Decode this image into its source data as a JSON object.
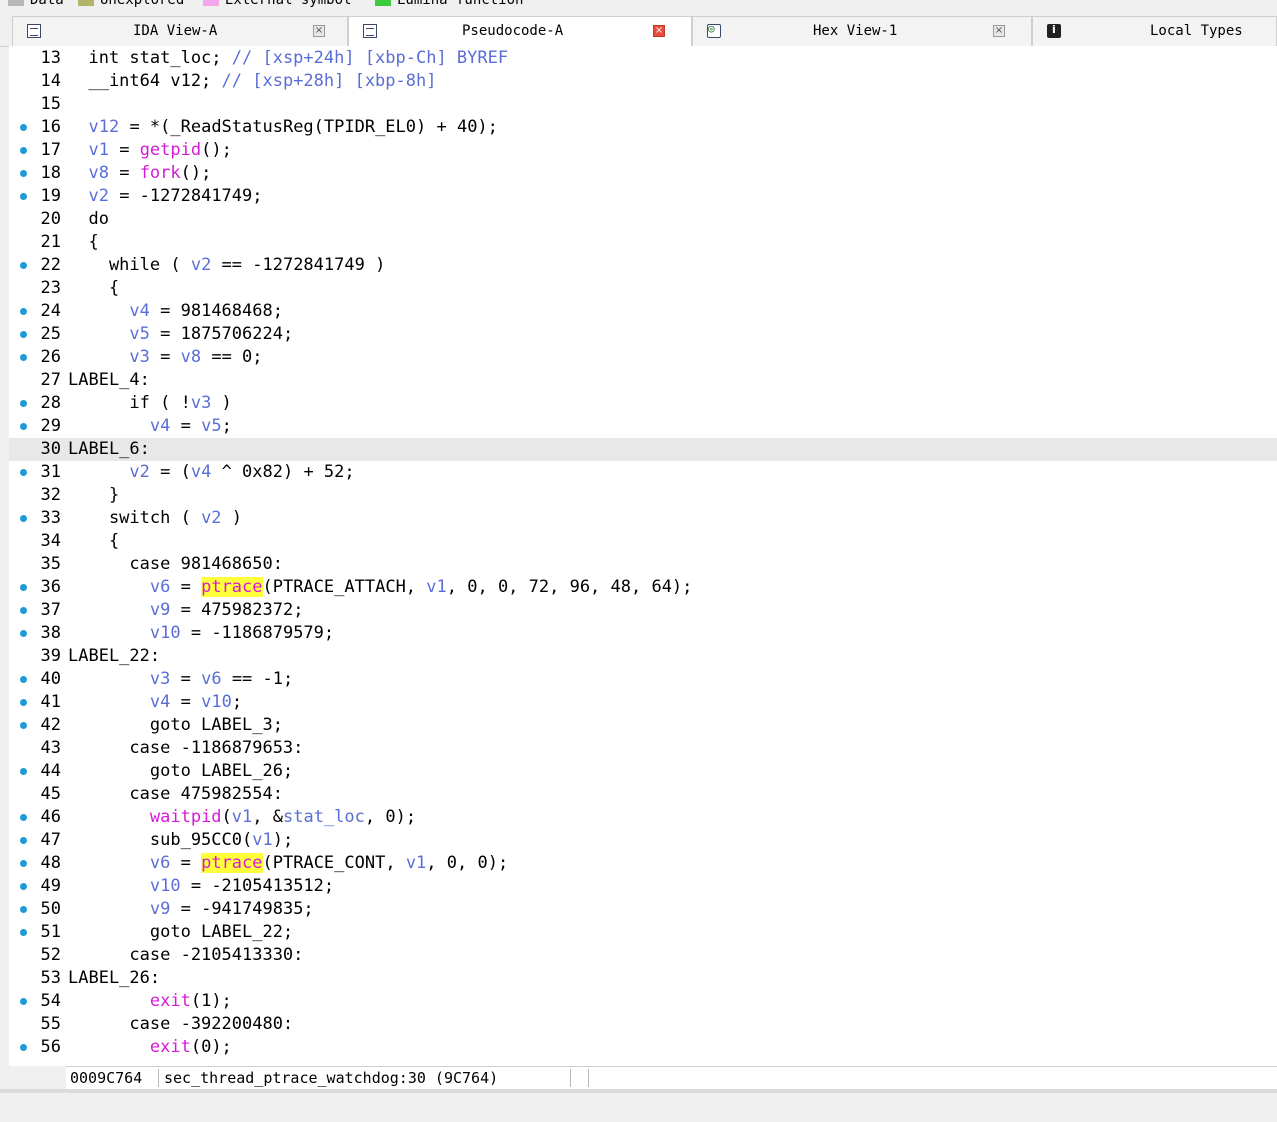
{
  "legend": [
    {
      "label": "Data",
      "color": "#b8b8b8"
    },
    {
      "label": "Unexplored",
      "color": "#b3b36b"
    },
    {
      "label": "External symbol",
      "color": "#f5a6ea"
    },
    {
      "label": "Lumina function",
      "color": "#3dcc3d"
    }
  ],
  "tabs": [
    {
      "label": "IDA View-A",
      "icon": "disassembly-icon",
      "active": false,
      "close": "close-icon"
    },
    {
      "label": "Pseudocode-A",
      "icon": "pseudocode-icon",
      "active": true,
      "close": "close-icon"
    },
    {
      "label": "Hex View-1",
      "icon": "hex-view-icon",
      "active": false,
      "close": "close-icon"
    },
    {
      "label": "Local Types",
      "icon": "info-icon",
      "active": false
    }
  ],
  "code": [
    {
      "n": "13",
      "dot": false,
      "src": "  int stat_loc; // [xsp+24h] [xbp-Ch] BYREF"
    },
    {
      "n": "14",
      "dot": false,
      "src": "  __int64 v12; // [xsp+28h] [xbp-8h]"
    },
    {
      "n": "15",
      "dot": false,
      "src": ""
    },
    {
      "n": "16",
      "dot": true,
      "src": "  v12 = *(_ReadStatusReg(TPIDR_EL0) + 40);"
    },
    {
      "n": "17",
      "dot": true,
      "src": "  v1 = getpid();"
    },
    {
      "n": "18",
      "dot": true,
      "src": "  v8 = fork();"
    },
    {
      "n": "19",
      "dot": true,
      "src": "  v2 = -1272841749;"
    },
    {
      "n": "20",
      "dot": false,
      "src": "  do"
    },
    {
      "n": "21",
      "dot": false,
      "src": "  {"
    },
    {
      "n": "22",
      "dot": true,
      "src": "    while ( v2 == -1272841749 )"
    },
    {
      "n": "23",
      "dot": false,
      "src": "    {"
    },
    {
      "n": "24",
      "dot": true,
      "src": "      v4 = 981468468;"
    },
    {
      "n": "25",
      "dot": true,
      "src": "      v5 = 1875706224;"
    },
    {
      "n": "26",
      "dot": true,
      "src": "      v3 = v8 == 0;"
    },
    {
      "n": "27",
      "dot": false,
      "src": "LABEL_4:"
    },
    {
      "n": "28",
      "dot": true,
      "src": "      if ( !v3 )"
    },
    {
      "n": "29",
      "dot": true,
      "src": "        v4 = v5;"
    },
    {
      "n": "30",
      "dot": false,
      "src": "LABEL_6:",
      "current": true
    },
    {
      "n": "31",
      "dot": true,
      "src": "      v2 = (v4 ^ 0x82) + 52;"
    },
    {
      "n": "32",
      "dot": false,
      "src": "    }"
    },
    {
      "n": "33",
      "dot": true,
      "src": "    switch ( v2 )"
    },
    {
      "n": "34",
      "dot": false,
      "src": "    {"
    },
    {
      "n": "35",
      "dot": false,
      "src": "      case 981468650:"
    },
    {
      "n": "36",
      "dot": true,
      "src": "        v6 = ptrace(PTRACE_ATTACH, v1, 0, 0, 72, 96, 48, 64);"
    },
    {
      "n": "37",
      "dot": true,
      "src": "        v9 = 475982372;"
    },
    {
      "n": "38",
      "dot": true,
      "src": "        v10 = -1186879579;"
    },
    {
      "n": "39",
      "dot": false,
      "src": "LABEL_22:"
    },
    {
      "n": "40",
      "dot": true,
      "src": "        v3 = v6 == -1;"
    },
    {
      "n": "41",
      "dot": true,
      "src": "        v4 = v10;"
    },
    {
      "n": "42",
      "dot": true,
      "src": "        goto LABEL_3;"
    },
    {
      "n": "43",
      "dot": false,
      "src": "      case -1186879653:"
    },
    {
      "n": "44",
      "dot": true,
      "src": "        goto LABEL_26;"
    },
    {
      "n": "45",
      "dot": false,
      "src": "      case 475982554:"
    },
    {
      "n": "46",
      "dot": true,
      "src": "        waitpid(v1, &stat_loc, 0);"
    },
    {
      "n": "47",
      "dot": true,
      "src": "        sub_95CC0(v1);"
    },
    {
      "n": "48",
      "dot": true,
      "src": "        v6 = ptrace(PTRACE_CONT, v1, 0, 0);"
    },
    {
      "n": "49",
      "dot": true,
      "src": "        v10 = -2105413512;"
    },
    {
      "n": "50",
      "dot": true,
      "src": "        v9 = -941749835;"
    },
    {
      "n": "51",
      "dot": true,
      "src": "        goto LABEL_22;"
    },
    {
      "n": "52",
      "dot": false,
      "src": "      case -2105413330:"
    },
    {
      "n": "53",
      "dot": false,
      "src": "LABEL_26:"
    },
    {
      "n": "54",
      "dot": true,
      "src": "        exit(1);"
    },
    {
      "n": "55",
      "dot": false,
      "src": "      case -392200480:"
    },
    {
      "n": "56",
      "dot": true,
      "src": "        exit(0);"
    }
  ],
  "highlight_word": "ptrace",
  "colors": {
    "variable": "#5a6ed6",
    "function": "#d61ad6",
    "highlight": "#ffff3b",
    "dot": "#1e9ad6"
  },
  "status": {
    "address": "0009C764",
    "location": "sec_thread_ptrace_watchdog:30 (9C764)"
  }
}
